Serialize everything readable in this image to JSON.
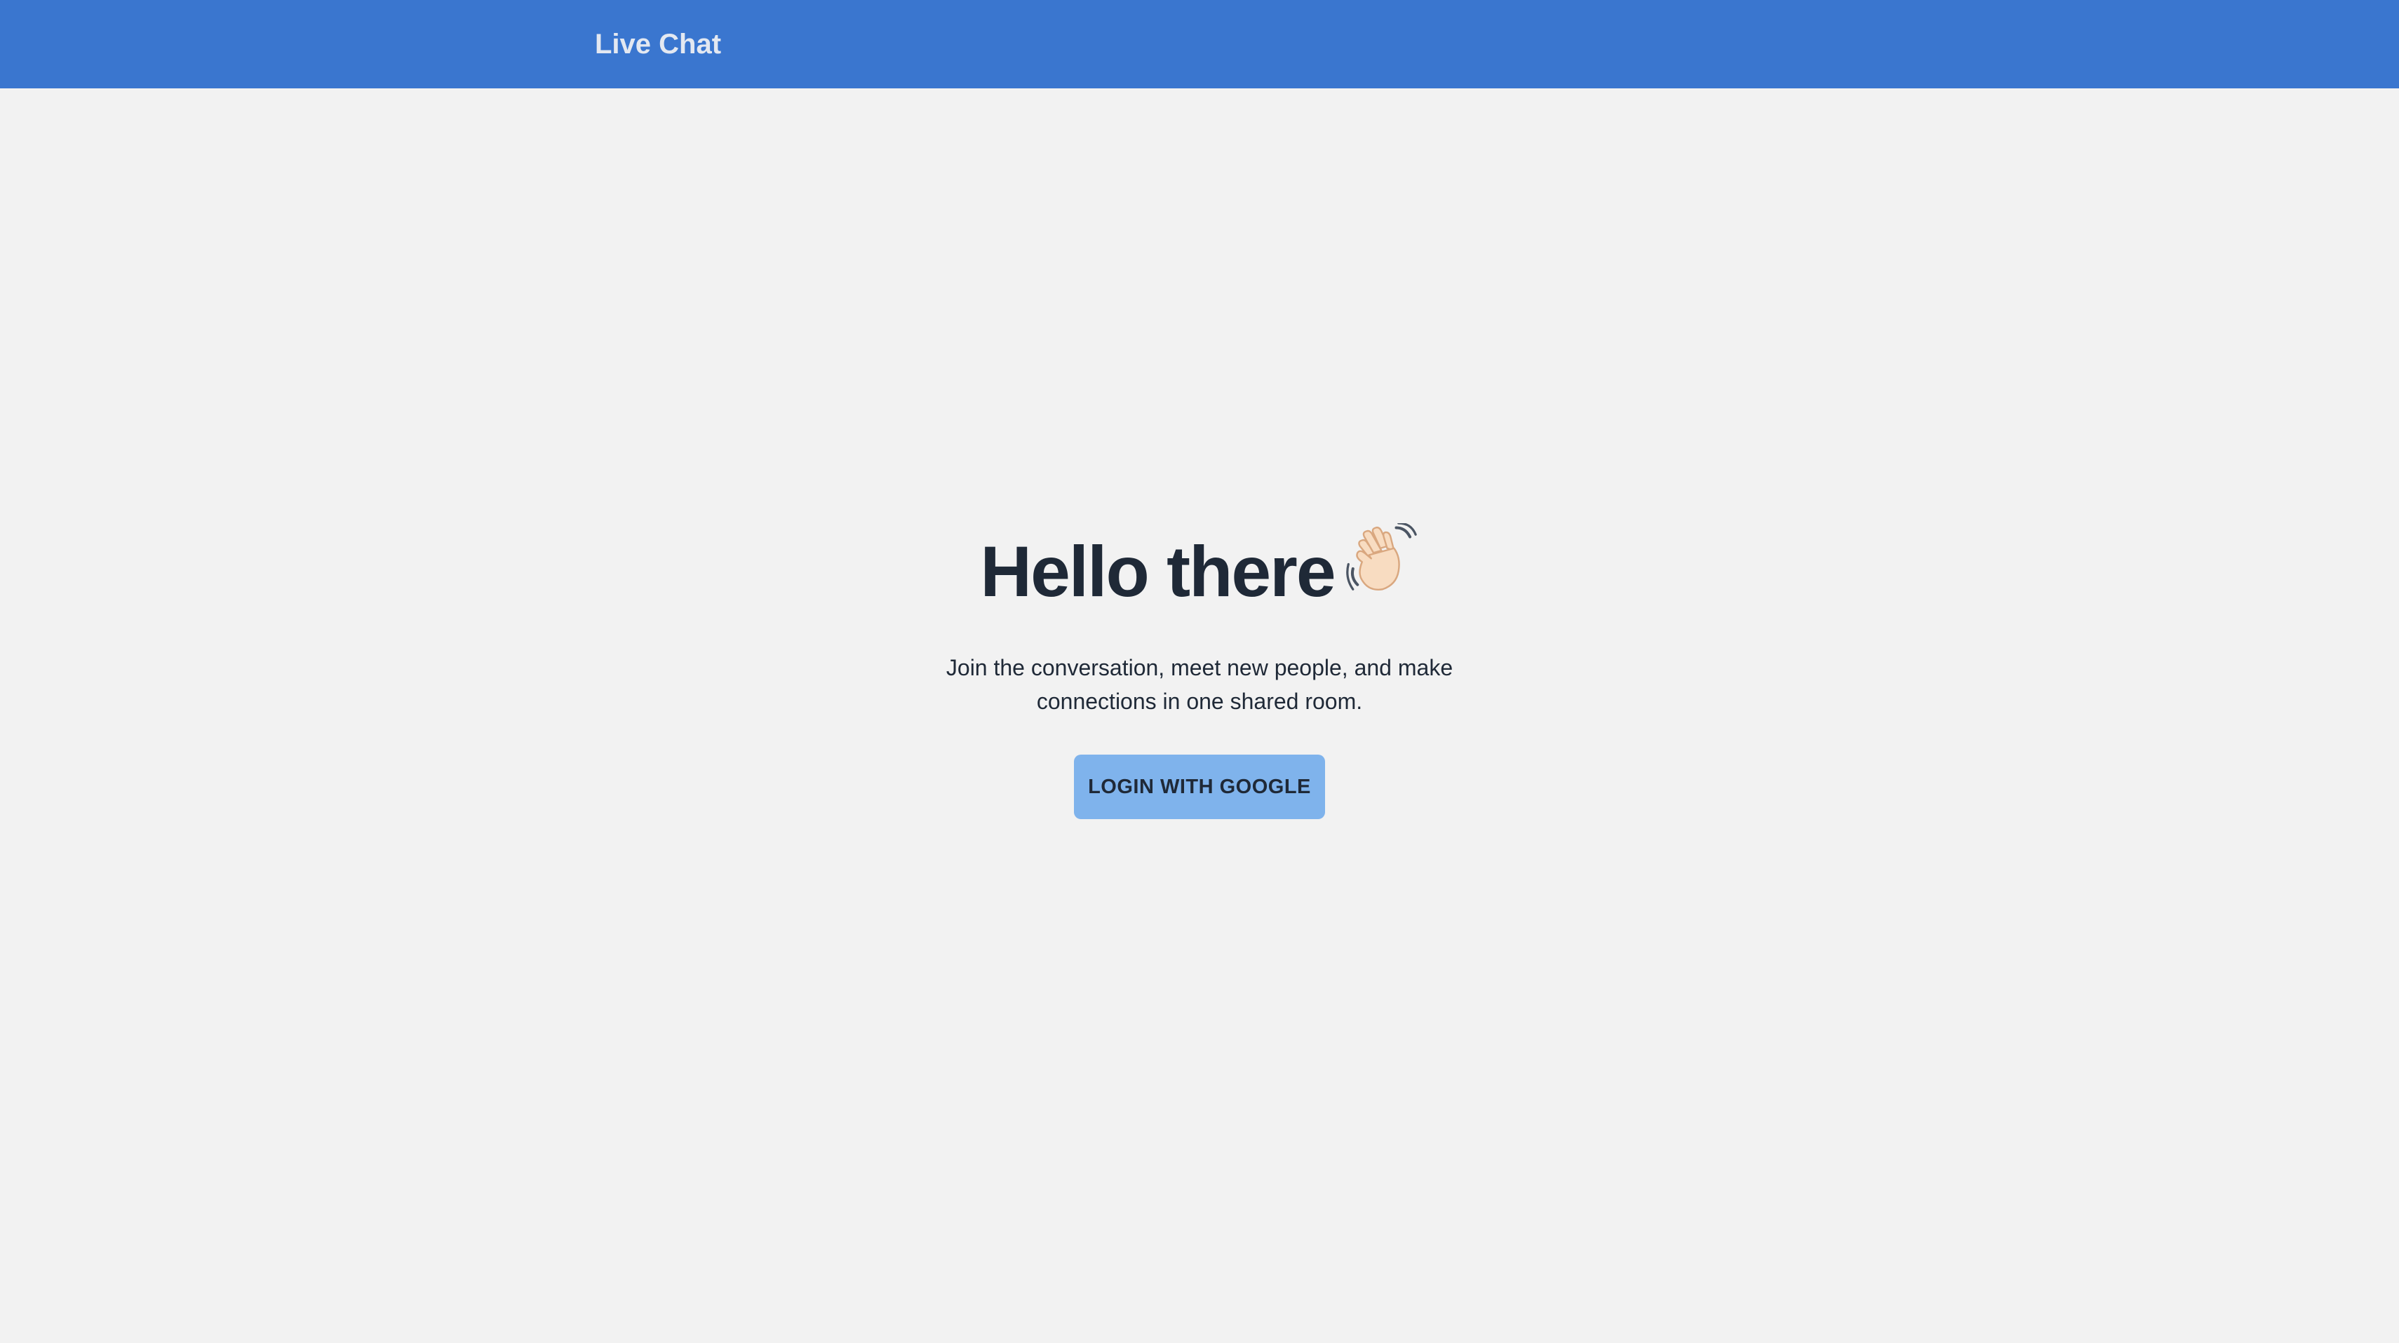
{
  "navbar": {
    "brand": "Live Chat",
    "color": "#3a76cf"
  },
  "hero": {
    "title": "Hello there",
    "emoji_icon": "waving-hand-icon",
    "description": "Join the conversation, meet new people, and make connections in one shared room.",
    "login_button_label": "LOGIN WITH GOOGLE",
    "button_color": "#7fb3ec"
  }
}
